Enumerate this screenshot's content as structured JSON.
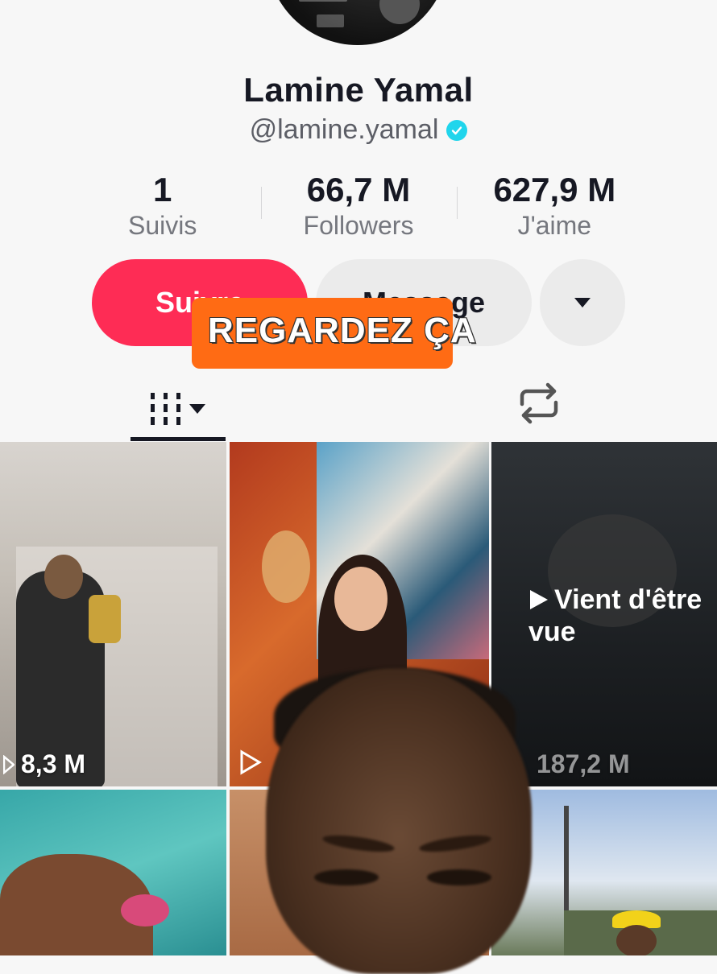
{
  "profile": {
    "name": "Lamine Yamal",
    "handle": "@lamine.yamal",
    "verified": true
  },
  "stats": [
    {
      "value": "1",
      "label": "Suivis"
    },
    {
      "value": "66,7 M",
      "label": "Followers"
    },
    {
      "value": "627,9 M",
      "label": "J'aime"
    }
  ],
  "actions": {
    "follow_label": "Suivre",
    "message_label": "Message",
    "more_icon": "caret-down-icon"
  },
  "overlay": {
    "caption": "REGARDEZ ÇA"
  },
  "tabs": {
    "videos_icon": "grid-icon",
    "reposts_icon": "repost-icon"
  },
  "grid": {
    "items": [
      {
        "views": "8,3 M"
      },
      {
        "views": ""
      },
      {
        "views": "187,2 M",
        "badge": "Vient d'être vue"
      }
    ]
  },
  "colors": {
    "accent": "#fe2c55",
    "verified": "#20d5ec",
    "overlay_bg": "#ff6b14"
  }
}
